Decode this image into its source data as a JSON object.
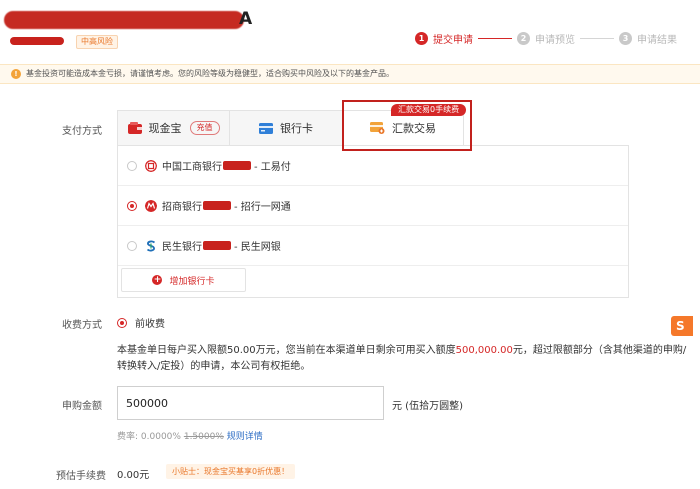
{
  "header": {
    "title_suffix": "A",
    "risk_tag": "中高风险"
  },
  "steps": [
    {
      "num": "1",
      "label": "提交申请"
    },
    {
      "num": "2",
      "label": "申请预览"
    },
    {
      "num": "3",
      "label": "申请结果"
    }
  ],
  "notice": {
    "icon": "!",
    "text": "基金投资可能造成本金亏损，请谨慎考虑。您的风险等级为稳健型，适合购买中风险及以下的基金产品。"
  },
  "payment": {
    "label": "支付方式",
    "tabs": [
      {
        "label": "现金宝",
        "tag": "充值"
      },
      {
        "label": "银行卡"
      },
      {
        "label": "汇款交易"
      }
    ],
    "fee_badge": "汇款交易0手续费",
    "banks": [
      {
        "logo_text": "工",
        "name": "中国工商银行",
        "suffix": "- 工易付"
      },
      {
        "logo_text": "M",
        "name": "招商银行",
        "suffix": "- 招行一网通"
      },
      {
        "logo_text": "S",
        "name": "民生银行",
        "suffix": "- 民生网银"
      }
    ],
    "add_card": "增加银行卡"
  },
  "fee_mode": {
    "label": "收费方式",
    "option": "前收费"
  },
  "limit_notice": {
    "part1": "本基金单日每户买入限额50.00万元，您当前在本渠道单日剩余可用买入额度",
    "amount": "500,000.00",
    "part2": "元，超过限额部分（含其他渠道的申购/转换转入/定投）的申请，本公司有权拒绝。"
  },
  "amount": {
    "label": "申购金额",
    "value": "500000",
    "unit": "元  (伍拾万圆整)"
  },
  "fee_rate": {
    "prefix": "费率:",
    "current": "0.0000%",
    "original": "1.5000%",
    "rules_link": "规则详情"
  },
  "est_fee": {
    "label": "预估手续费",
    "value": "0.00元",
    "tip": "小贴士：现金宝买基享0折优惠！"
  },
  "colors": {
    "accent": "#d52727",
    "highlight": "#c2211d",
    "notice_bg": "#fff9ee",
    "orange": "#e9772a"
  }
}
